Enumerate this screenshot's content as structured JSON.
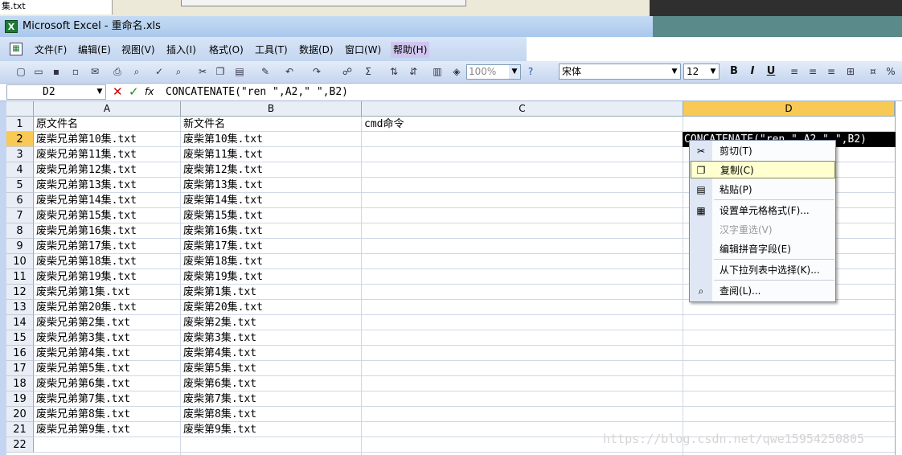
{
  "desktop": {
    "file_label": "集.txt"
  },
  "window": {
    "app_icon": "X",
    "title": "Microsoft Excel - 重命名.xls"
  },
  "menus": [
    "文件(F)",
    "编辑(E)",
    "视图(V)",
    "插入(I)",
    "格式(O)",
    "工具(T)",
    "数据(D)",
    "窗口(W)",
    "帮助(H)"
  ],
  "toolbar": {
    "zoom": "100%",
    "font": "宋体",
    "font_size": "12",
    "bold": "B",
    "italic": "I",
    "underline": "U",
    "percent": "%",
    "sigma": "Σ"
  },
  "formula_bar": {
    "name_box": "D2",
    "fx": "fx",
    "formula": "CONCATENATE(\"ren \",A2,\" \",B2)"
  },
  "columns": [
    "A",
    "B",
    "C",
    "D"
  ],
  "rows": [
    {
      "n": "1",
      "a": "原文件名",
      "b": "新文件名",
      "c": "cmd命令"
    },
    {
      "n": "2",
      "a": "废柴兄弟第10集.txt",
      "b": "废柴第10集.txt",
      "c": ""
    },
    {
      "n": "3",
      "a": "废柴兄弟第11集.txt",
      "b": "废柴第11集.txt",
      "c": ""
    },
    {
      "n": "4",
      "a": "废柴兄弟第12集.txt",
      "b": "废柴第12集.txt",
      "c": ""
    },
    {
      "n": "5",
      "a": "废柴兄弟第13集.txt",
      "b": "废柴第13集.txt",
      "c": ""
    },
    {
      "n": "6",
      "a": "废柴兄弟第14集.txt",
      "b": "废柴第14集.txt",
      "c": ""
    },
    {
      "n": "7",
      "a": "废柴兄弟第15集.txt",
      "b": "废柴第15集.txt",
      "c": ""
    },
    {
      "n": "8",
      "a": "废柴兄弟第16集.txt",
      "b": "废柴第16集.txt",
      "c": ""
    },
    {
      "n": "9",
      "a": "废柴兄弟第17集.txt",
      "b": "废柴第17集.txt",
      "c": ""
    },
    {
      "n": "10",
      "a": "废柴兄弟第18集.txt",
      "b": "废柴第18集.txt",
      "c": ""
    },
    {
      "n": "11",
      "a": "废柴兄弟第19集.txt",
      "b": "废柴第19集.txt",
      "c": ""
    },
    {
      "n": "12",
      "a": "废柴兄弟第1集.txt",
      "b": "废柴第1集.txt",
      "c": ""
    },
    {
      "n": "13",
      "a": "废柴兄弟第20集.txt",
      "b": "废柴第20集.txt",
      "c": ""
    },
    {
      "n": "14",
      "a": "废柴兄弟第2集.txt",
      "b": "废柴第2集.txt",
      "c": ""
    },
    {
      "n": "15",
      "a": "废柴兄弟第3集.txt",
      "b": "废柴第3集.txt",
      "c": ""
    },
    {
      "n": "16",
      "a": "废柴兄弟第4集.txt",
      "b": "废柴第4集.txt",
      "c": ""
    },
    {
      "n": "17",
      "a": "废柴兄弟第5集.txt",
      "b": "废柴第5集.txt",
      "c": ""
    },
    {
      "n": "18",
      "a": "废柴兄弟第6集.txt",
      "b": "废柴第6集.txt",
      "c": ""
    },
    {
      "n": "19",
      "a": "废柴兄弟第7集.txt",
      "b": "废柴第7集.txt",
      "c": ""
    },
    {
      "n": "20",
      "a": "废柴兄弟第8集.txt",
      "b": "废柴第8集.txt",
      "c": ""
    },
    {
      "n": "21",
      "a": "废柴兄弟第9集.txt",
      "b": "废柴第9集.txt",
      "c": ""
    },
    {
      "n": "22",
      "a": "",
      "b": "",
      "c": ""
    }
  ],
  "active_cell": {
    "ref": "D2",
    "text": "CONCATENATE(\"ren \",A2,\" \",B2)"
  },
  "context_menu": [
    {
      "label": "剪切(T)",
      "icon": "scissors-icon",
      "state": "normal"
    },
    {
      "label": "复制(C)",
      "icon": "copy-icon",
      "state": "highlighted"
    },
    {
      "label": "粘贴(P)",
      "icon": "paste-icon",
      "state": "normal"
    },
    {
      "label": "设置单元格格式(F)...",
      "icon": "format-cells-icon",
      "state": "normal"
    },
    {
      "label": "汉字重选(V)",
      "icon": "",
      "state": "disabled"
    },
    {
      "label": "编辑拼音字段(E)",
      "icon": "",
      "state": "normal"
    },
    {
      "label": "从下拉列表中选择(K)...",
      "icon": "",
      "state": "normal"
    },
    {
      "label": "查阅(L)...",
      "icon": "lookup-icon",
      "state": "normal"
    }
  ],
  "watermark": "https://blog.csdn.net/qwe15954250805",
  "colors": {
    "selected_header": "#f9c955",
    "menu_highlight": "#ffffd0",
    "title_gradient": "#a9c8ec"
  }
}
